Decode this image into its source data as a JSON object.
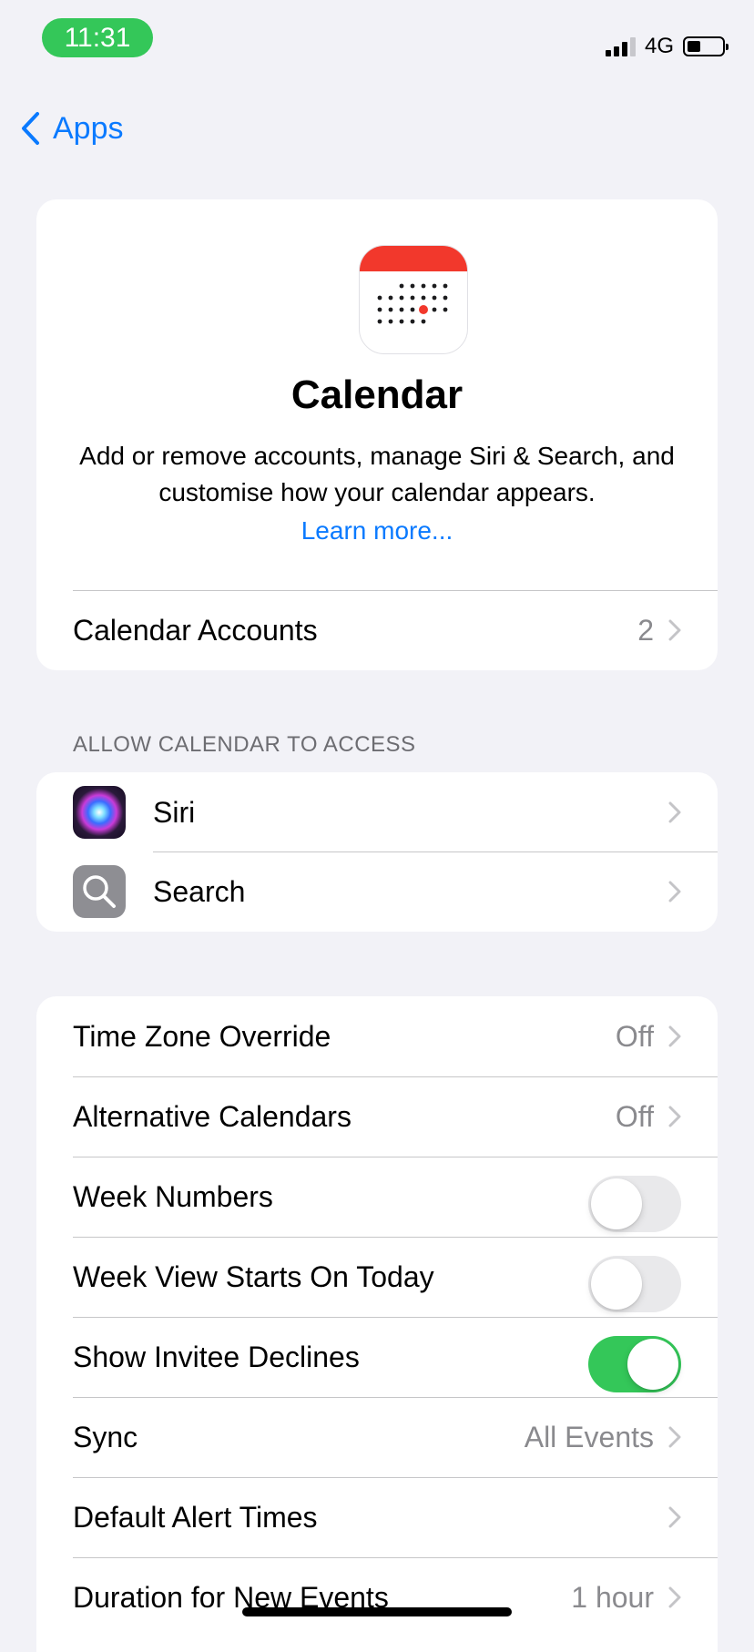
{
  "status_bar": {
    "time": "11:31",
    "network": "4G"
  },
  "nav": {
    "back_label": "Apps"
  },
  "hero": {
    "title": "Calendar",
    "description": "Add or remove accounts, manage Siri & Search, and customise how your calendar appears.",
    "link": "Learn more..."
  },
  "accounts_row": {
    "label": "Calendar Accounts",
    "value": "2"
  },
  "access_section": {
    "header": "ALLOW CALENDAR TO ACCESS",
    "items": [
      {
        "label": "Siri",
        "icon": "siri-icon"
      },
      {
        "label": "Search",
        "icon": "magnifier-icon"
      }
    ]
  },
  "settings": {
    "time_zone_override": {
      "label": "Time Zone Override",
      "value": "Off"
    },
    "alternative_calendars": {
      "label": "Alternative Calendars",
      "value": "Off"
    },
    "week_numbers": {
      "label": "Week Numbers",
      "on": false
    },
    "week_view_starts_today": {
      "label": "Week View Starts On Today",
      "on": false
    },
    "show_invitee_declines": {
      "label": "Show Invitee Declines",
      "on": true
    },
    "sync": {
      "label": "Sync",
      "value": "All Events"
    },
    "default_alert_times": {
      "label": "Default Alert Times"
    },
    "duration_new_events": {
      "label": "Duration for New Events",
      "value": "1 hour"
    }
  },
  "colors": {
    "accent": "#0a7aff",
    "toggle_on": "#34c759",
    "calendar_red": "#f2382c"
  }
}
